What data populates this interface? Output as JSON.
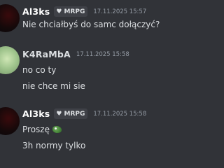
{
  "messages": [
    {
      "author": "Al3ks",
      "author_color": "#ffffff",
      "badge": {
        "icon": "heart-icon",
        "label": "MRPG"
      },
      "timestamp": "17.11.2025 15:57",
      "lines": [
        "Nie chciałbyś do samc dołączyć?"
      ]
    },
    {
      "author": "K4RaMbA",
      "author_color": "#dbdee1",
      "timestamp": "17.11.2025 15:58",
      "lines": [
        "no co ty",
        "nie chce mi sie"
      ]
    },
    {
      "author": "Al3ks",
      "author_color": "#ffffff",
      "badge": {
        "icon": "heart-icon",
        "label": "MRPG"
      },
      "timestamp": "17.11.2025 15:58",
      "lines": [
        "Proszę",
        "3h normy tylko"
      ],
      "emoji": "pepe-emoji"
    }
  ]
}
